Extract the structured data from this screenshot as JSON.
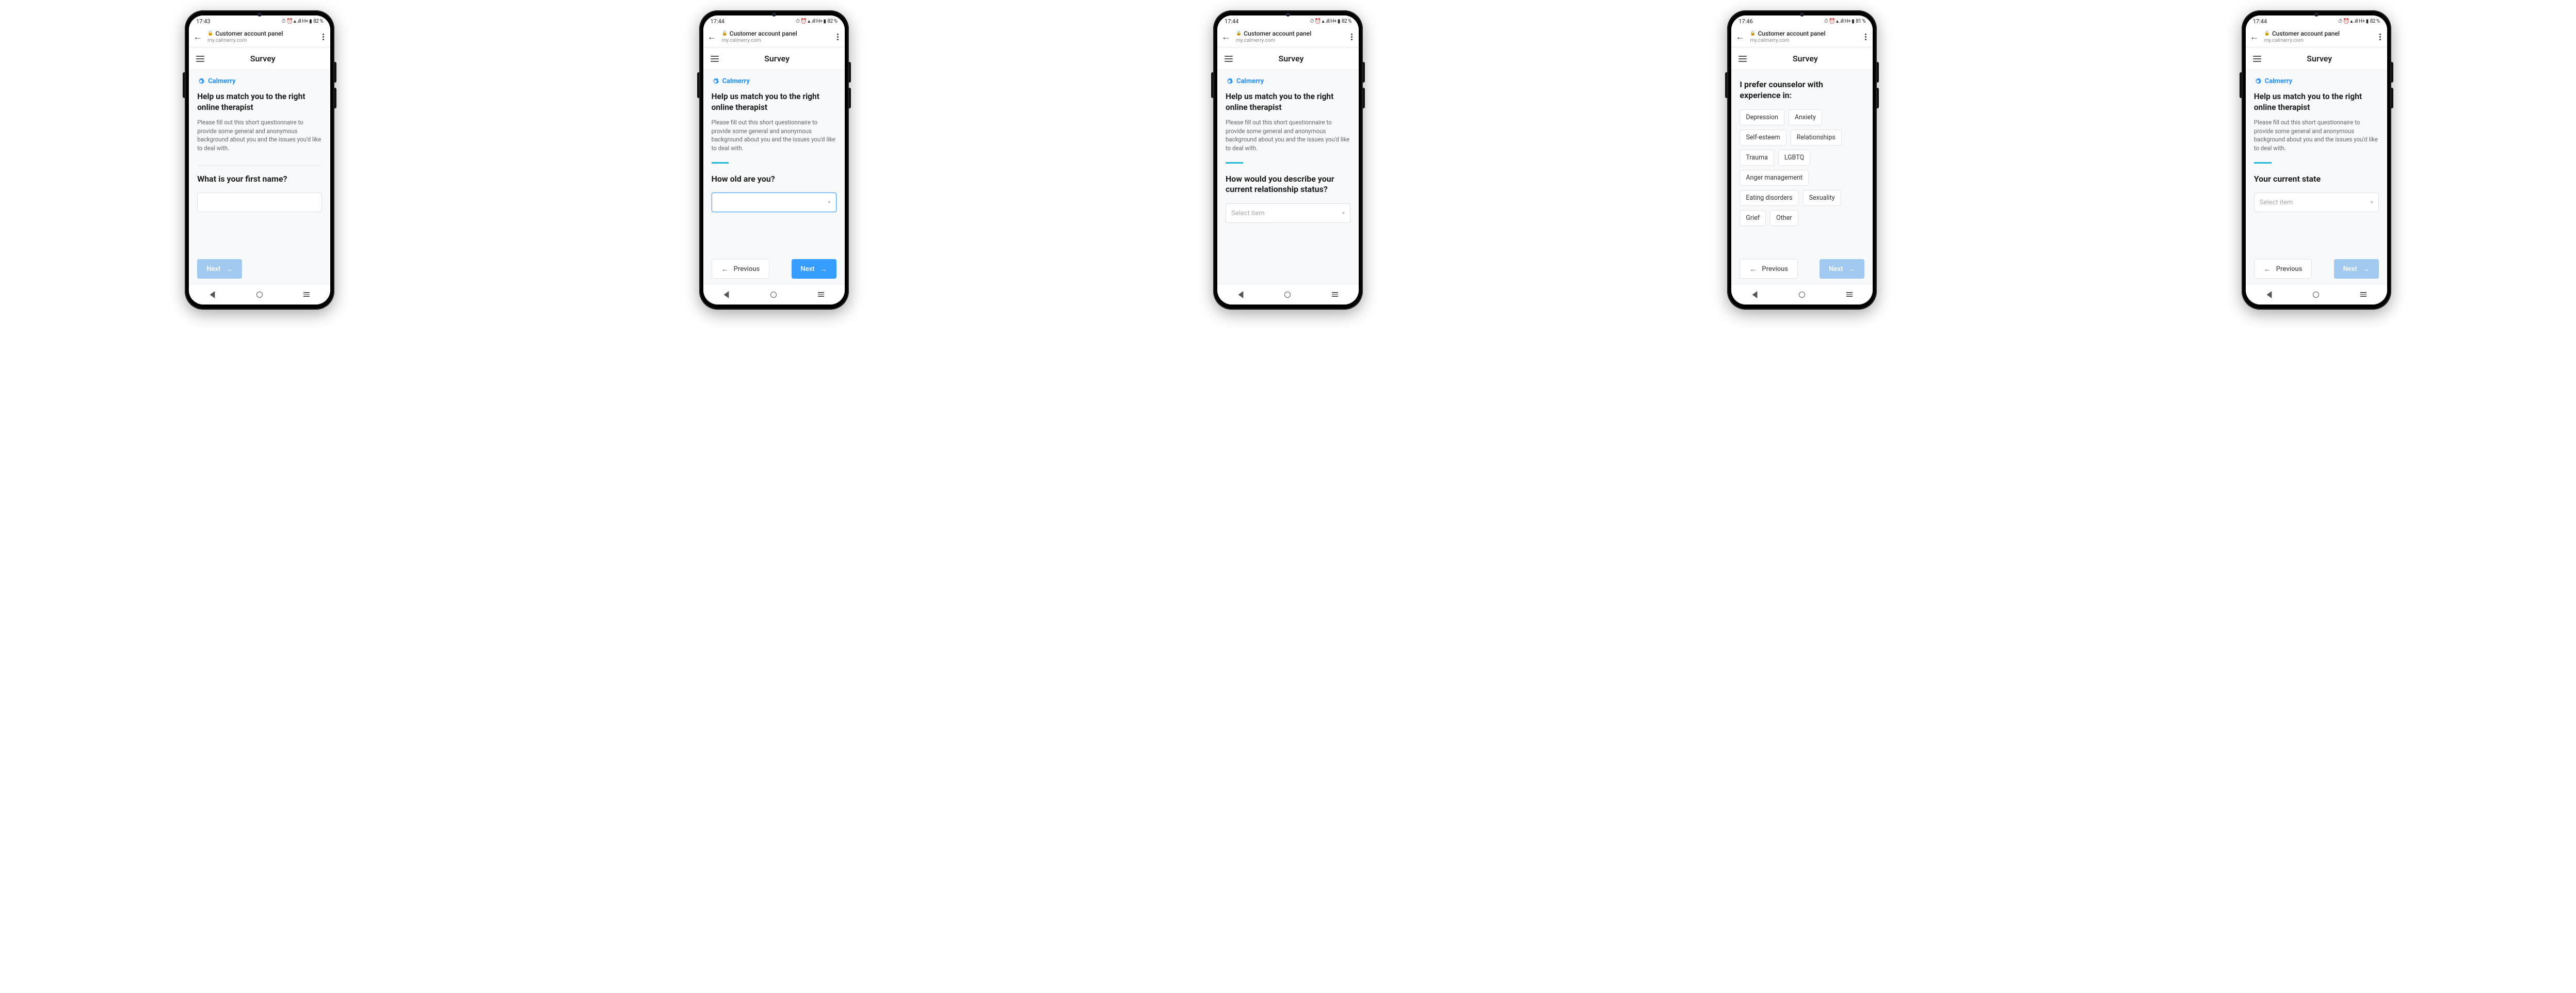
{
  "status": {
    "icons_text": "⏰ ⏱ 📶 H+ 🔋",
    "battery": [
      "82 %",
      "82 %",
      "82 %",
      "81 %",
      "82 %"
    ],
    "times": [
      "17:43",
      "17:44",
      "17:44",
      "17:46",
      "17:44"
    ]
  },
  "browser": {
    "title": "Customer account panel",
    "url": "my.calmerry.com"
  },
  "app": {
    "title": "Survey",
    "brand": "Calmerry"
  },
  "intro": {
    "heading": "Help us match you to the right online therapist",
    "desc": "Please fill out this short questionnaire to provide some general and anonymous background about you and the issues you'd like to deal with."
  },
  "buttons": {
    "next": "Next",
    "previous": "Previous"
  },
  "screens": [
    {
      "question": "What is your first name?",
      "progress_pct": 0,
      "has_prev": false,
      "next_soft": true,
      "input_kind": "text"
    },
    {
      "question": "How old are you?",
      "progress_pct": 14,
      "has_prev": true,
      "next_soft": false,
      "input_kind": "select_focused",
      "placeholder": ""
    },
    {
      "question": "How would you describe your current relationship status?",
      "progress_pct": 14,
      "has_prev": false,
      "next_soft": false,
      "input_kind": "select",
      "placeholder": "Select item"
    },
    {
      "question": "I prefer counselor with experience in:",
      "progress_pct": 0,
      "has_prev": true,
      "next_soft": true,
      "input_kind": "chips",
      "chips": [
        "Depression",
        "Anxiety",
        "Self-esteem",
        "Relationships",
        "Trauma",
        "LGBTQ",
        "Anger management",
        "Eating disorders",
        "Sexuality",
        "Grief",
        "Other"
      ]
    },
    {
      "question": "Your current state",
      "progress_pct": 14,
      "has_prev": true,
      "next_soft": true,
      "input_kind": "select",
      "placeholder": "Select item"
    }
  ]
}
